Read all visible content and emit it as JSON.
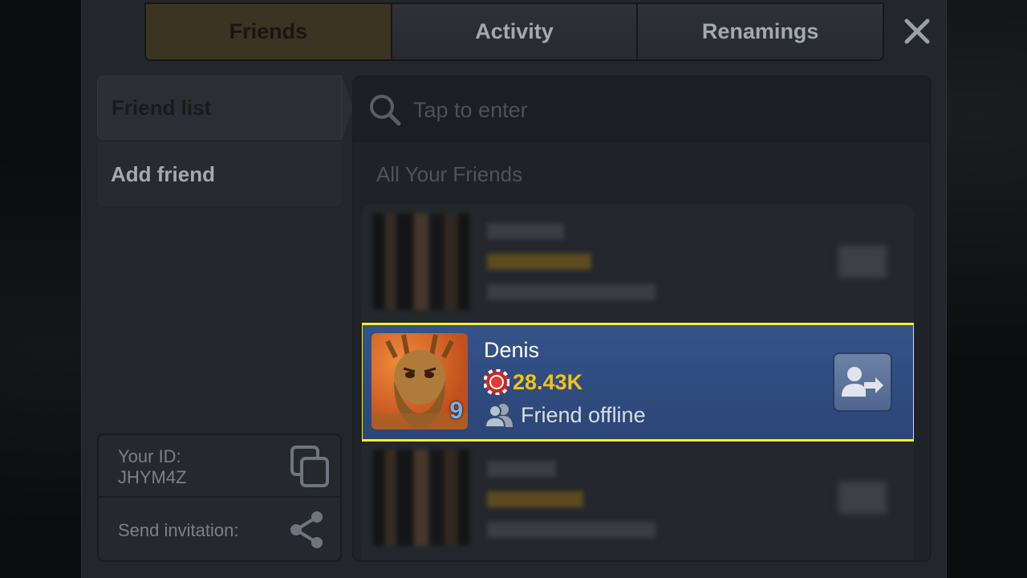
{
  "tabs": [
    {
      "label": "Friends",
      "active": true
    },
    {
      "label": "Activity",
      "active": false
    },
    {
      "label": "Renamings",
      "active": false
    }
  ],
  "menu": {
    "friend_list": "Friend list",
    "add_friend": "Add friend"
  },
  "your_id": {
    "label": "Your ID:",
    "value": "JHYM4Z"
  },
  "invite": {
    "label": "Send invitation:"
  },
  "search": {
    "placeholder": "Tap to enter"
  },
  "section_title": "All Your Friends",
  "friends": [
    {
      "name": "Denis",
      "chips": "28.43K",
      "status": "Friend offline",
      "level": "9",
      "selected": true
    }
  ],
  "colors": {
    "accent_selected_border": "#f2f02a",
    "chips": "#f2c21a",
    "selected_row": "#2f4b7f",
    "level": "#6fb1f2"
  },
  "icons": [
    "close-icon",
    "search-icon",
    "copy-icon",
    "share-icon",
    "chip-icon",
    "user-offline-icon",
    "user-transfer-icon"
  ]
}
